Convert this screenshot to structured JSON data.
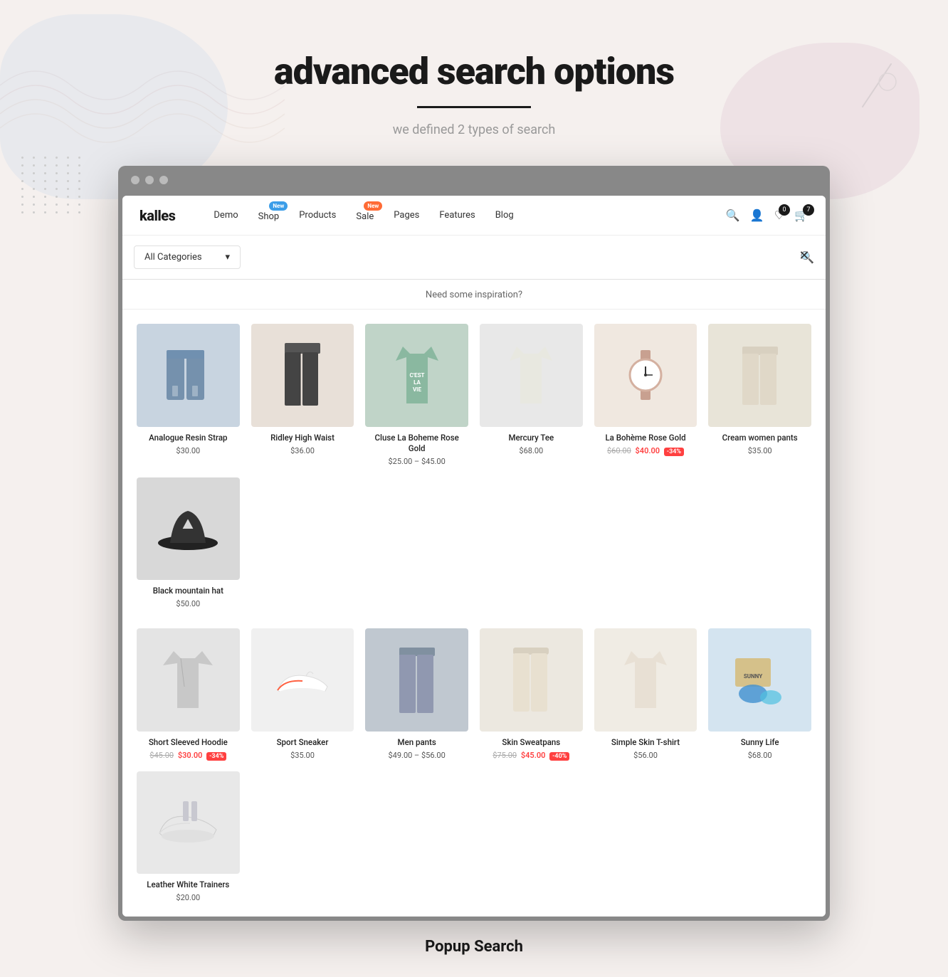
{
  "page": {
    "title": "advanced search  options",
    "title_underline": true,
    "subtitle": "we defined 2 types of search"
  },
  "nav": {
    "logo": "kalles",
    "links": [
      {
        "label": "Demo",
        "badge": null
      },
      {
        "label": "Shop",
        "badge": {
          "text": "New",
          "color": "blue"
        }
      },
      {
        "label": "Products",
        "badge": null
      },
      {
        "label": "Sale",
        "badge": {
          "text": "New",
          "color": "orange"
        }
      },
      {
        "label": "Pages",
        "badge": null
      },
      {
        "label": "Features",
        "badge": null
      },
      {
        "label": "Blog",
        "badge": null
      }
    ],
    "icons": [
      {
        "name": "search",
        "symbol": "🔍",
        "count": null
      },
      {
        "name": "user",
        "symbol": "👤",
        "count": null
      },
      {
        "name": "wishlist",
        "symbol": "♡",
        "count": "0"
      },
      {
        "name": "cart",
        "symbol": "🛒",
        "count": "7"
      }
    ]
  },
  "search": {
    "category_placeholder": "All Categories",
    "input_placeholder": "",
    "inspiration_label": "Need some inspiration?"
  },
  "products_row1": [
    {
      "name": "Analogue Resin Strap",
      "price": "$30.00",
      "old_price": null,
      "discount": null,
      "img_class": "img-jeans"
    },
    {
      "name": "Ridley High Waist",
      "price": "$36.00",
      "old_price": null,
      "discount": null,
      "img_class": "img-pants"
    },
    {
      "name": "Cluse La Boheme Rose Gold",
      "price": "$25.00 – $45.00",
      "old_price": null,
      "discount": null,
      "img_class": "img-tshirt-green"
    },
    {
      "name": "Mercury Tee",
      "price": "$68.00",
      "old_price": null,
      "discount": null,
      "img_class": "img-tshirt-white"
    },
    {
      "name": "La Bohème Rose Gold",
      "price": "$40.00",
      "old_price": "$60.00",
      "discount": "-34%",
      "img_class": "img-watch"
    },
    {
      "name": "Cream women pants",
      "price": "$35.00",
      "old_price": null,
      "discount": null,
      "img_class": "img-cream-pants"
    },
    {
      "name": "Black mountain hat",
      "price": "$50.00",
      "old_price": null,
      "discount": null,
      "img_class": "img-hat"
    }
  ],
  "products_row2": [
    {
      "name": "Short Sleeved Hoodie",
      "price": "$30.00",
      "old_price": "$45.00",
      "discount": "-34%",
      "img_class": "img-sweater"
    },
    {
      "name": "Sport Sneaker",
      "price": "$35.00",
      "old_price": null,
      "discount": null,
      "img_class": "img-sneaker"
    },
    {
      "name": "Men pants",
      "price": "$49.00 – $56.00",
      "old_price": null,
      "discount": null,
      "img_class": "img-jeans-men"
    },
    {
      "name": "Skin Sweatpans",
      "price": "$45.00",
      "old_price": "$75.00",
      "discount": "-40%",
      "img_class": "img-sweatpants"
    },
    {
      "name": "Simple Skin T-shirt",
      "price": "$56.00",
      "old_price": null,
      "discount": null,
      "img_class": "img-skin-tshirt"
    },
    {
      "name": "Sunny Life",
      "price": "$68.00",
      "old_price": null,
      "discount": null,
      "img_class": "img-pool-toys"
    },
    {
      "name": "Leather White Trainers",
      "price": "$20.00",
      "old_price": null,
      "discount": null,
      "img_class": "img-trainers"
    }
  ],
  "popup_label": "Popup Search"
}
